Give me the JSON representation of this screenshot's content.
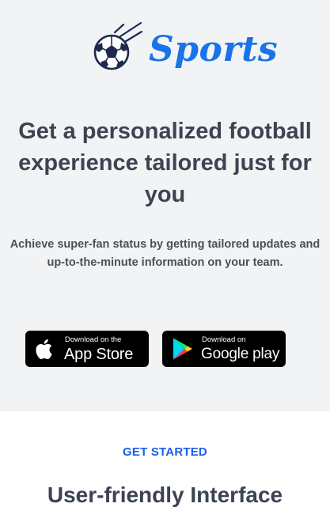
{
  "brand": {
    "name": "Sports",
    "logo_icon": "soccer-ball-icon",
    "color": "#1a73e8",
    "ball_color": "#1c2a4d"
  },
  "hero": {
    "headline": "Get a personalized football experience tailored just for you",
    "subtext": "Achieve super-fan status by getting tailored updates and up-to-the-minute information on your team.",
    "background": "#f2f3f4"
  },
  "badges": {
    "apple": {
      "small": "Download on the",
      "big": "App Store",
      "icon": "apple-icon"
    },
    "google": {
      "small": "Download on",
      "big": "Google play",
      "icon": "google-play-icon"
    }
  },
  "cta": {
    "label": "GET STARTED",
    "color": "#1a5ee8"
  },
  "features": {
    "title": "User-friendly Interface"
  }
}
